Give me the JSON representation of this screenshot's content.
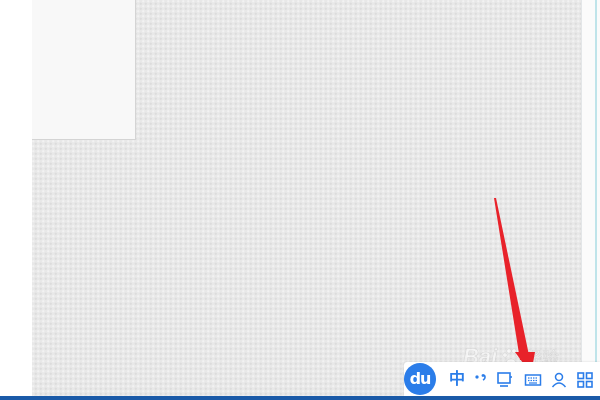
{
  "watermark": {
    "brand_text": "Bai",
    "paw_icon": "paw-icon",
    "suffix_text": "经验"
  },
  "ime_toolbar": {
    "logo_text": "du",
    "mode_label": "中",
    "icons": [
      "punctuation-icon",
      "skin-icon",
      "soft-keyboard-icon",
      "user-icon",
      "menu-grid-icon"
    ]
  },
  "colors": {
    "canvas": "#e8e8e8",
    "ime_blue": "#2b7de9",
    "arrow_red": "#e8222a",
    "taskbar_line": "#1a5aa8"
  }
}
